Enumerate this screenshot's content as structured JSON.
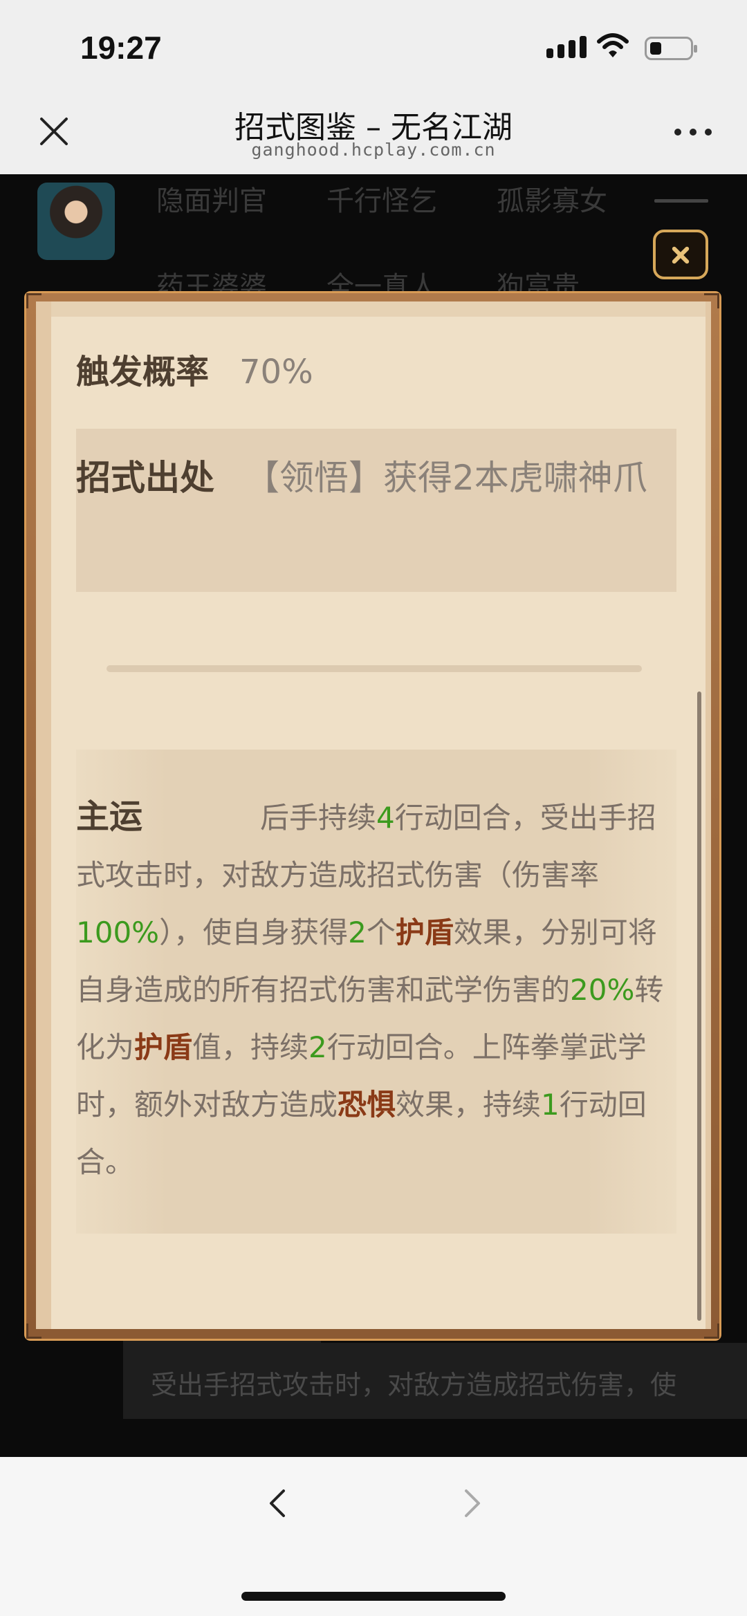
{
  "status": {
    "time": "19:27"
  },
  "nav": {
    "title": "招式图鉴 – 无名江湖",
    "url": "ganghood.hcplay.com.cn"
  },
  "background": {
    "npcs_row1": [
      "隐面判官",
      "千行怪乞",
      "孤影寡女"
    ],
    "npcs_row2": [
      "药王婆婆",
      "全一真人",
      "狗富贵"
    ],
    "desc": "受出手招式攻击时，对敌方造成招式伤害，使"
  },
  "dialog": {
    "prob_label": "触发概率",
    "prob_value": "70%",
    "origin_label": "招式出处",
    "origin_value": "【领悟】获得2本虎啸神爪",
    "main": {
      "label": "主运",
      "t1": "后手持续",
      "n1": "4",
      "t2": "行动回合，受出手招式攻击时，对敌方造成招式伤害（伤害率",
      "n2": "100%",
      "t3": "），使自身获得",
      "n3": "2",
      "t4": "个",
      "k1": "护盾",
      "t5": "效果，分别可将自身造成的所有招式伤害和武学伤害的",
      "n4": "20%",
      "t6": "转化为",
      "k2": "护盾",
      "t7": "值，持续",
      "n5": "2",
      "t8": "行动回合。上阵拳掌武学时，额外对敌方造成",
      "k3": "恐惧",
      "t9": "效果，持续",
      "n6": "1",
      "t10": "行动回合。"
    }
  },
  "colors": {
    "highlight_green": "#3c9a1e",
    "keyword_brown": "#8a3a17",
    "frame_gold": "#d89b55"
  },
  "icons": [
    "close-icon",
    "more-icon",
    "back-chevron-icon",
    "forward-chevron-icon",
    "signal-icon",
    "wifi-icon",
    "battery-icon",
    "hamburger-menu-icon"
  ]
}
